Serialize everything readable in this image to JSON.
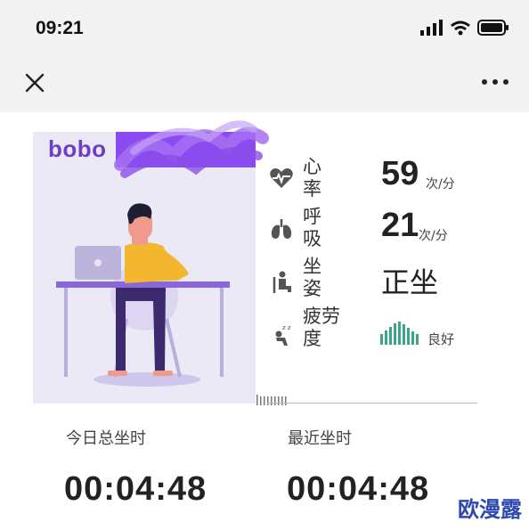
{
  "status_bar": {
    "time": "09:21"
  },
  "header": {
    "close_icon": "close-icon",
    "more_icon": "more-icon"
  },
  "profile": {
    "name": "bobo"
  },
  "metrics": {
    "heart_rate": {
      "label": "心\n率",
      "value": "59",
      "unit": "次/分",
      "icon": "heart-icon"
    },
    "breathing": {
      "label": "呼\n吸",
      "value": "21",
      "unit": "次/分",
      "icon": "lungs-icon"
    },
    "posture": {
      "label": "坐\n姿",
      "value": "正坐",
      "icon": "sitting-icon"
    },
    "fatigue": {
      "label": "疲劳\n度",
      "value": "良好",
      "icon": "sleepy-icon",
      "bar_color": "#3aa58c"
    }
  },
  "stats": {
    "today": {
      "label": "今日总坐时",
      "value": "00:04:48"
    },
    "recent": {
      "label": "最近坐时",
      "value": "00:04:48"
    }
  },
  "watermark": "欧漫露",
  "colors": {
    "accent": "#8a4cf0",
    "card_bg": "#ece9f7",
    "fatigue_bars": "#3aa58c"
  }
}
